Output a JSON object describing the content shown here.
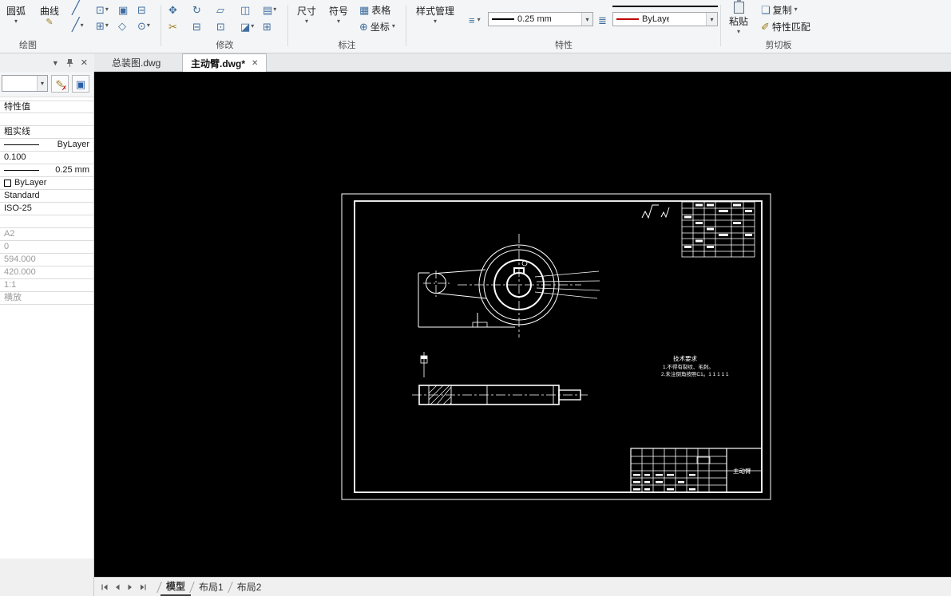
{
  "colors": {
    "current_color_sample": "#c00000",
    "canvas_background": "#000000"
  },
  "ribbon": {
    "draw": {
      "label": "绘图",
      "arc": "圆弧",
      "curve": "曲线"
    },
    "modify": {
      "label": "修改"
    },
    "annotate": {
      "label": "标注",
      "dimension": "尺寸",
      "symbol": "符号",
      "table": "表格",
      "coordinate": "坐标"
    },
    "properties": {
      "label": "特性",
      "style_manager": "样式管理",
      "lineweight": "0.25 mm",
      "color": "ByLayer"
    },
    "clipboard": {
      "label": "剪切板",
      "paste": "粘贴",
      "copy": "复制",
      "match": "特性匹配"
    }
  },
  "doc_tabs": {
    "tab1": "总装图.dwg",
    "tab2": "主动臂.dwg*"
  },
  "panel": {
    "header": "特性值",
    "linetype": "粗实线",
    "linetype_layer": "ByLayer",
    "plot_lineweight": "0.100",
    "lineweight": "0.25 mm",
    "color_layer": "ByLayer",
    "text_style": "Standard",
    "dim_style": "ISO-25",
    "paper_size": "A2",
    "layout_value": "0",
    "paper_width": "594.000",
    "paper_height": "420.000",
    "scale": "1:1",
    "orientation": "横放"
  },
  "drawing": {
    "tech_title": "技术要求",
    "tech_line1": "1.不得有裂纹、毛刺。",
    "tech_line2": "2.未注倒角按照C1。1 1 1 1 1",
    "part_name": "主动臂"
  },
  "statusbar": {
    "model_tab": "模型",
    "layout1_tab": "布局1",
    "layout2_tab": "布局2"
  }
}
